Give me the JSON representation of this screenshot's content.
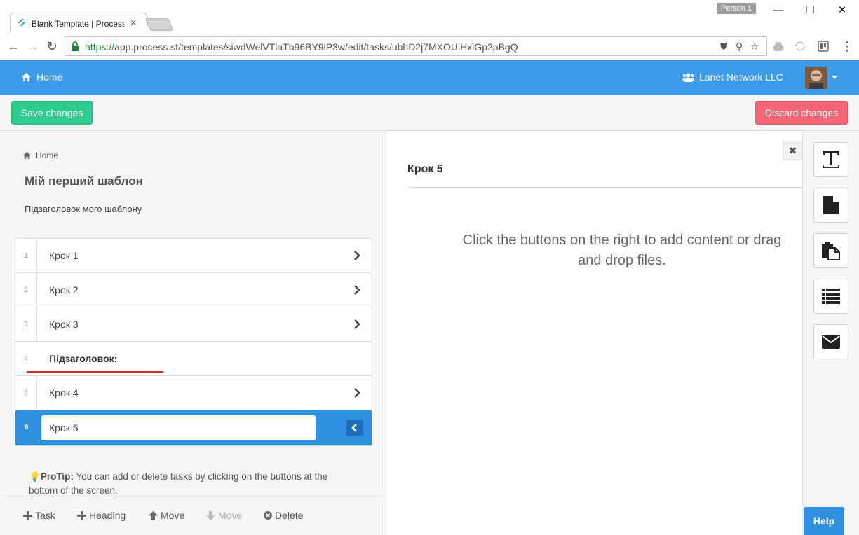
{
  "browser": {
    "tab_title": "Blank Template | Process",
    "profile": "Person 1",
    "url_scheme": "https://",
    "url_rest": "app.process.st/templates/siwdWelVTlaTb96BY9lP3w/edit/tasks/ubhD2j7MXOUiHxiGp2pBgQ"
  },
  "header": {
    "home_label": "Home",
    "org_label": "Lanet Network LLC"
  },
  "actions": {
    "save_label": "Save changes",
    "discard_label": "Discard changes"
  },
  "sidebar": {
    "breadcrumb": "Home",
    "template_title": "Мій перший шаблон",
    "template_subtitle": "Підзаголовок мого шаблону",
    "tasks": [
      {
        "num": "1",
        "label": "Крок 1"
      },
      {
        "num": "2",
        "label": "Крок 2"
      },
      {
        "num": "3",
        "label": "Крок 3"
      },
      {
        "num": "4",
        "label": "Підзаголовок:"
      },
      {
        "num": "5",
        "label": "Крок 4"
      },
      {
        "num": "6",
        "label": "Крок 5"
      }
    ],
    "protip_label": "ProTip:",
    "protip_text": " You can add or delete tasks by clicking on the buttons at the bottom of the screen."
  },
  "bottombar": {
    "task": "Task",
    "heading": "Heading",
    "move_up": "Move",
    "move_down": "Move",
    "delete": "Delete"
  },
  "main": {
    "step_title": "Крок 5",
    "empty_message": "Click the buttons on the right to add content or drag and drop files."
  },
  "rail": {
    "widgets": [
      "text-widget-icon",
      "file-widget-icon",
      "copy-widget-icon",
      "list-widget-icon",
      "email-widget-icon"
    ]
  },
  "help_label": "Help",
  "colors": {
    "primary": "#3d9be9",
    "save": "#2ecc8e",
    "discard": "#f46675",
    "active_task": "#2f8fe0"
  }
}
